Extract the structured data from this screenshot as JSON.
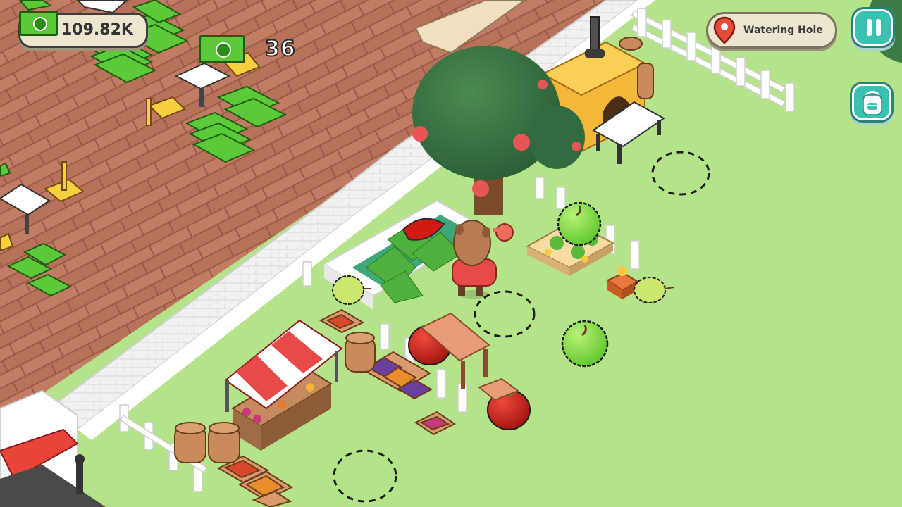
{
  "hud": {
    "money": {
      "icon": "cash-stack-icon",
      "value": "109.82K"
    },
    "cash_popup": {
      "icon": "cash-bill-icon",
      "count": "36"
    },
    "location": {
      "icon": "map-pin-icon",
      "name": "Watering Hole"
    },
    "buttons": {
      "pause": {
        "icon": "pause-icon"
      },
      "inventory": {
        "icon": "backpack-icon"
      }
    }
  },
  "colors": {
    "grass": "#b5e38a",
    "deck_wood": "#b9725a",
    "cash_green": "#5cc93a",
    "button_teal": "#39c2b2",
    "pill_cream": "#ece6cf",
    "pin_red": "#e64a3b"
  }
}
